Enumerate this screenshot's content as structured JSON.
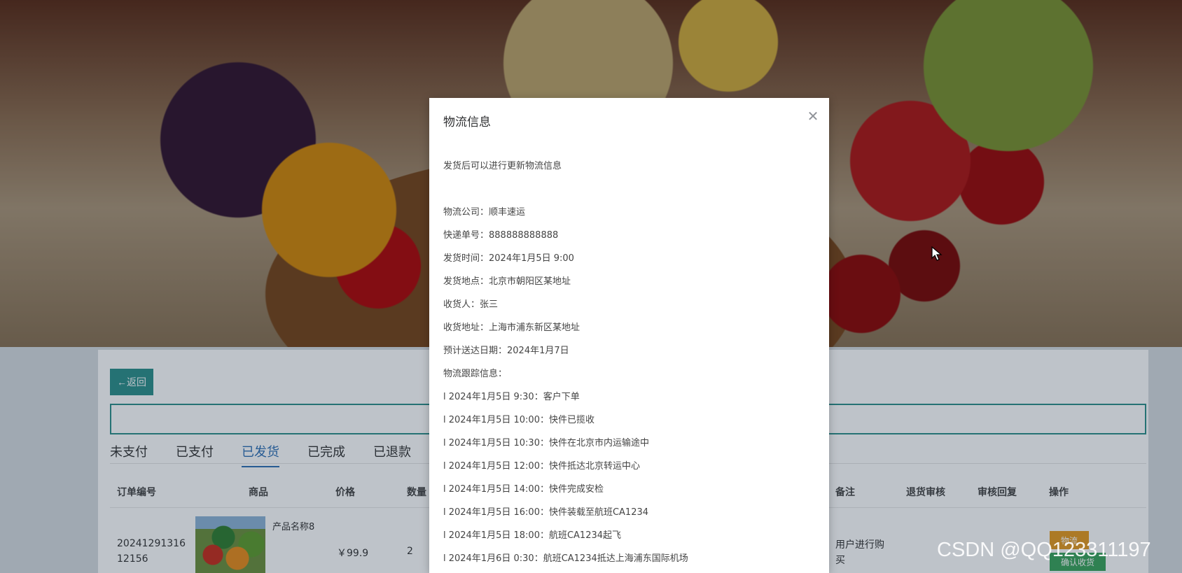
{
  "page": {
    "back_label": "←返回",
    "tabs": [
      {
        "label": "未支付",
        "active": false
      },
      {
        "label": "已支付",
        "active": false
      },
      {
        "label": "已发货",
        "active": true
      },
      {
        "label": "已完成",
        "active": false
      },
      {
        "label": "已退款",
        "active": false
      }
    ],
    "columns": [
      "订单编号",
      "商品",
      "价格",
      "数量",
      "备注",
      "退货审核",
      "审核回复",
      "操作"
    ],
    "order": {
      "order_no": "20241291316 12156",
      "product_name": "产品名称8",
      "price": "￥99.9",
      "quantity": "2",
      "remark": "用户进行购买",
      "btn_logistics": "物流",
      "btn_confirm": "确认收货"
    },
    "accent_color": "#2b8f8a"
  },
  "modal": {
    "title": "物流信息",
    "close_icon": "close-icon",
    "intro": "发货后可以进行更新物流信息",
    "company": "物流公司：顺丰速运",
    "tracking_no": "快递单号：888888888888",
    "ship_time": "发货时间：2024年1月5日 9:00",
    "ship_place": "发货地点：北京市朝阳区某地址",
    "receiver": "收货人：张三",
    "receiver_address": "收货地址：上海市浦东新区某地址",
    "eta": "预计送达日期：2024年1月7日",
    "tracking_header": "物流跟踪信息：",
    "tracking": [
      "l 2024年1月5日 9:30：客户下单",
      "l 2024年1月5日 10:00：快件已揽收",
      "l 2024年1月5日 10:30：快件在北京市内运输途中",
      "l 2024年1月5日 12:00：快件抵达北京转运中心",
      "l 2024年1月5日 14:00：快件完成安检",
      "l 2024年1月5日 16:00：快件装载至航班CA1234",
      "l 2024年1月5日 18:00：航班CA1234起飞",
      "l 2024年1月6日 0:30：航班CA1234抵达上海浦东国际机场"
    ]
  },
  "watermark": "CSDN @QQ123311197"
}
